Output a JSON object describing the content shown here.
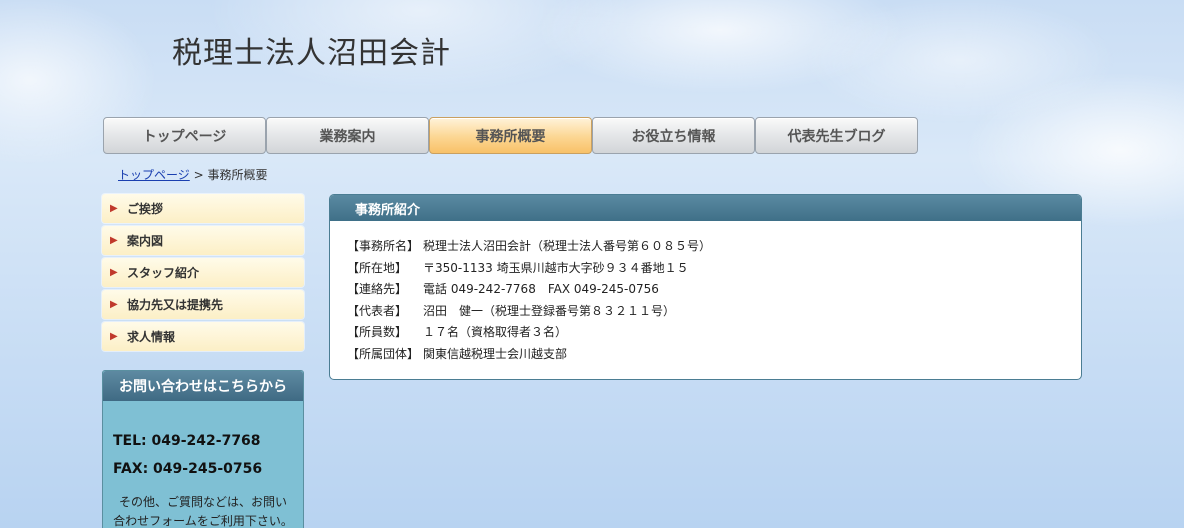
{
  "header": {
    "site_title": "税理士法人沼田会計"
  },
  "nav": {
    "tabs": [
      {
        "label": "トップページ"
      },
      {
        "label": "業務案内"
      },
      {
        "label": "事務所概要"
      },
      {
        "label": "お役立ち情報"
      },
      {
        "label": "代表先生ブログ"
      }
    ],
    "active": "事務所概要"
  },
  "breadcrumb": {
    "home": "トップページ",
    "separator": " > ",
    "current": "事務所概要"
  },
  "sidebar": {
    "items": [
      {
        "label": "ご挨拶"
      },
      {
        "label": "案内図"
      },
      {
        "label": "スタッフ紹介"
      },
      {
        "label": "協力先又は提携先"
      },
      {
        "label": "求人情報"
      }
    ]
  },
  "contact": {
    "title": "お問い合わせはこちらから",
    "tel": "TEL: 049-242-7768",
    "fax": "FAX: 049-245-0756",
    "note_line1": "その他、ご質問などは、お問い",
    "note_line2": "合わせフォームをご利用下さい。"
  },
  "main": {
    "title": "事務所紹介",
    "rows": [
      {
        "label": "【事務所名】",
        "value": "税理士法人沼田会計（税理士法人番号第６０８５号）"
      },
      {
        "label": "【所在地】",
        "value": "〒350-1133 埼玉県川越市大字砂９３４番地１５"
      },
      {
        "label": "【連絡先】",
        "value": "電話 049-242-7768　FAX 049-245-0756"
      },
      {
        "label": "【代表者】",
        "value": "沼田　健一（税理士登録番号第８３２１１号）"
      },
      {
        "label": "【所員数】",
        "value": "１７名（資格取得者３名）"
      },
      {
        "label": "【所属団体】",
        "value": "関東信越税理士会川越支部"
      }
    ]
  },
  "colors": {
    "accent_orange": "#f8c168",
    "header_bar": "#3f7088",
    "contact_bg": "#7fc0d4",
    "link": "#1a3fb0"
  }
}
